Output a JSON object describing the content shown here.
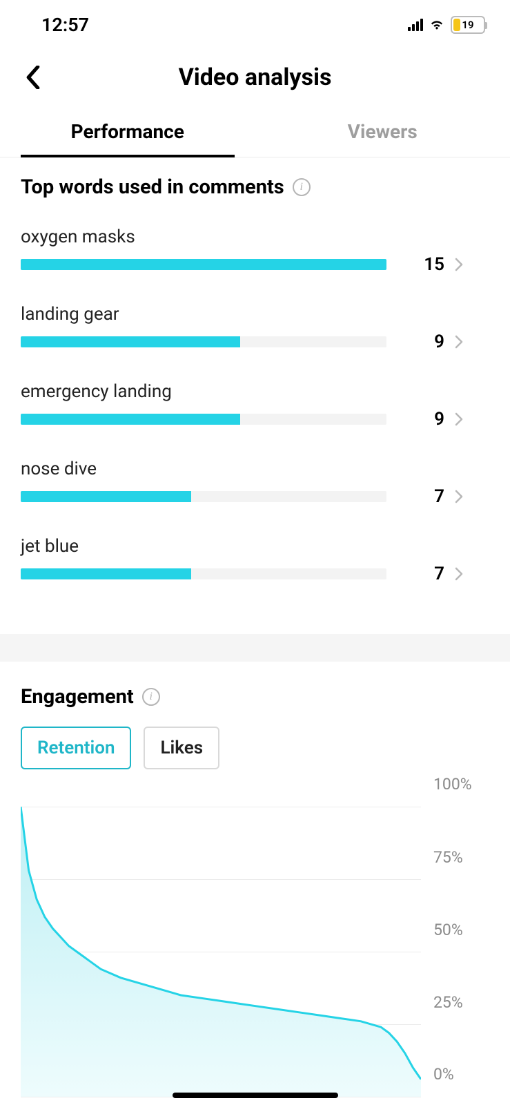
{
  "status_bar": {
    "time": "12:57",
    "battery_percent": "19"
  },
  "header": {
    "title": "Video analysis"
  },
  "tabs": {
    "performance": "Performance",
    "viewers": "Viewers",
    "active": "performance"
  },
  "top_words": {
    "title": "Top words used in comments",
    "max": 15,
    "items": [
      {
        "label": "oxygen masks",
        "count": 15
      },
      {
        "label": "landing gear",
        "count": 9
      },
      {
        "label": "emergency landing",
        "count": 9
      },
      {
        "label": "nose dive",
        "count": 7
      },
      {
        "label": "jet blue",
        "count": 7
      }
    ]
  },
  "engagement": {
    "title": "Engagement",
    "chips": {
      "retention": "Retention",
      "likes": "Likes",
      "active": "retention"
    },
    "y_axis": [
      "100%",
      "75%",
      "50%",
      "25%",
      "0%"
    ]
  },
  "chart_data": {
    "type": "area",
    "title": "Retention",
    "xlabel": "",
    "ylabel": "",
    "ylim": [
      0,
      100
    ],
    "x": [
      0,
      2,
      4,
      6,
      8,
      10,
      12,
      14,
      16,
      18,
      20,
      25,
      30,
      35,
      40,
      45,
      50,
      55,
      60,
      65,
      70,
      75,
      80,
      85,
      90,
      92,
      94,
      96,
      98,
      100
    ],
    "values": [
      100,
      78,
      68,
      62,
      58,
      55,
      52,
      50,
      48,
      46,
      44,
      41,
      39,
      37,
      35,
      34,
      33,
      32,
      31,
      30,
      29,
      28,
      27,
      26,
      24,
      22,
      19,
      15,
      10,
      6
    ]
  }
}
